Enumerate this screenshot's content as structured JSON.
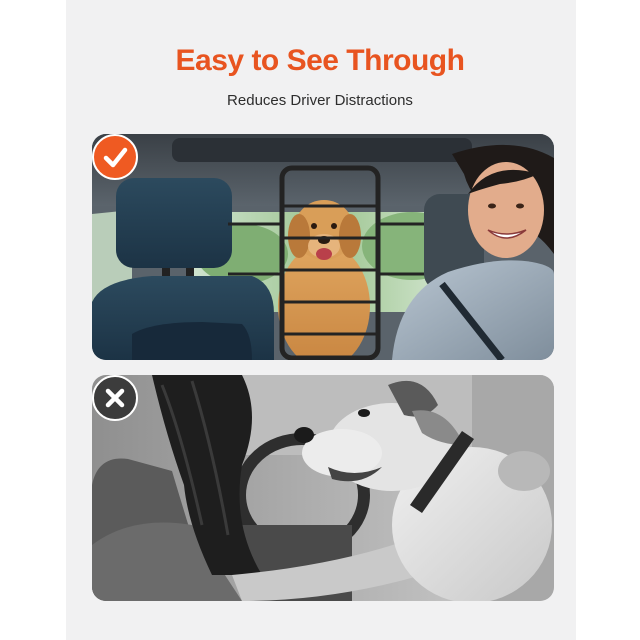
{
  "heading": {
    "title": "Easy to See Through",
    "subtitle": "Reduces Driver Distractions"
  },
  "comparison": {
    "good": {
      "badge_icon": "checkmark-icon",
      "badge_color": "#ef5a22",
      "scene": "golden retriever sitting behind a black metal car barrier while a smiling woman drives"
    },
    "bad": {
      "badge_icon": "cross-icon",
      "badge_color": "#3c3c3c",
      "scene": "grayscale photo of a dog leaning into the driver's seat next to a woman driving"
    }
  },
  "colors": {
    "accent": "#e85420",
    "panel_background": "#f1f1f2"
  }
}
